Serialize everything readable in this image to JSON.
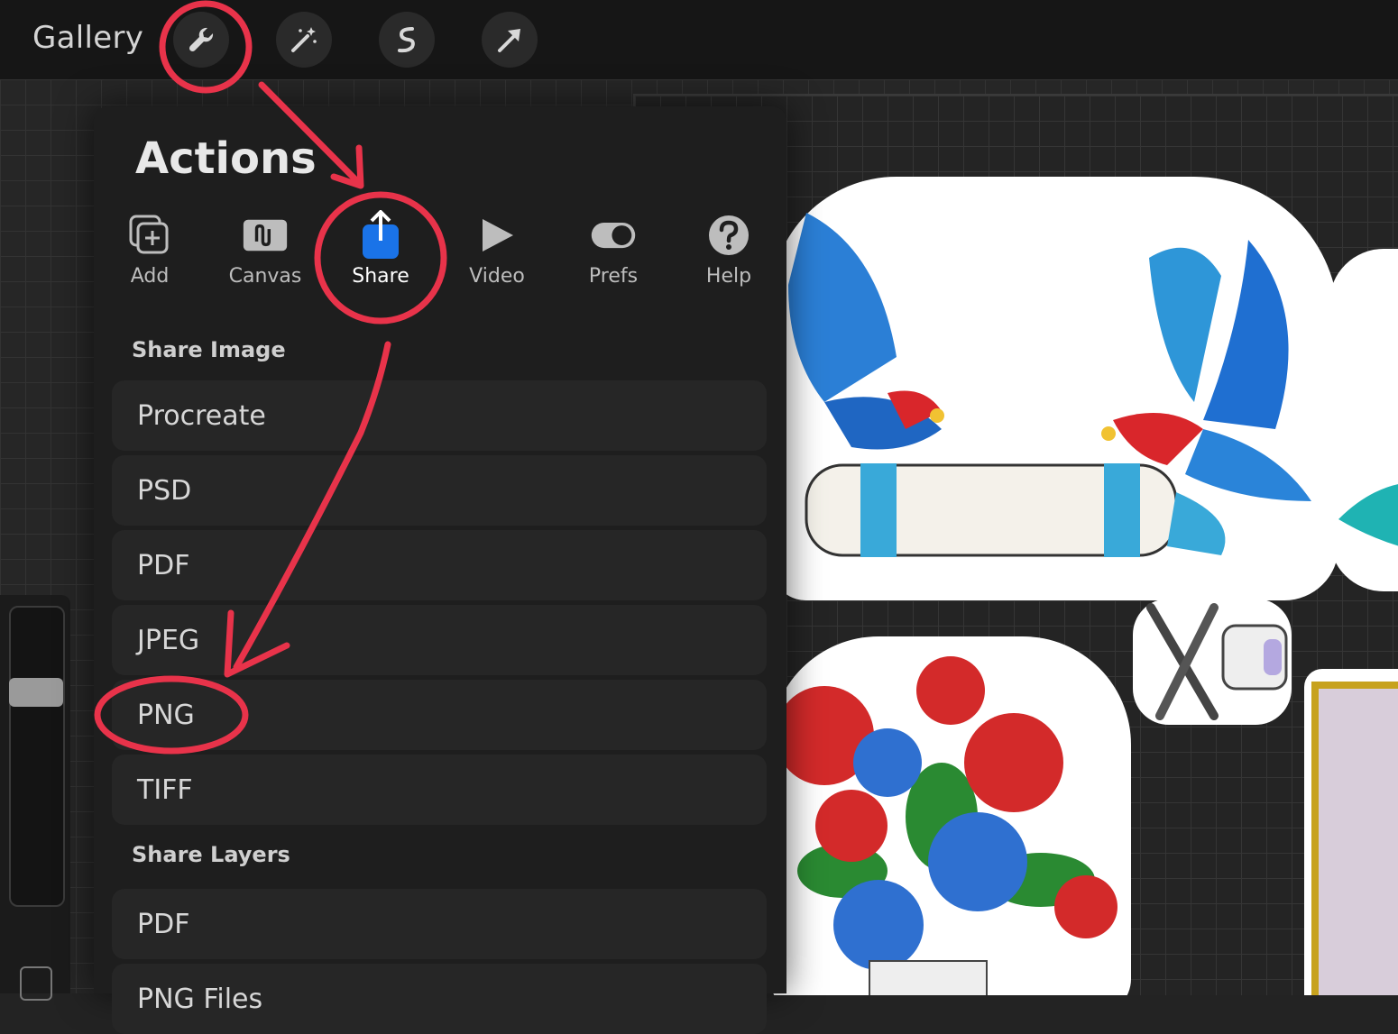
{
  "topbar": {
    "gallery_label": "Gallery",
    "tools": [
      {
        "icon": "wrench-icon"
      },
      {
        "icon": "magic-wand-icon"
      },
      {
        "icon": "selection-icon"
      },
      {
        "icon": "transform-arrow-icon"
      }
    ]
  },
  "panel": {
    "title": "Actions",
    "tabs": [
      {
        "label": "Add",
        "icon": "add-layer-icon"
      },
      {
        "label": "Canvas",
        "icon": "canvas-icon"
      },
      {
        "label": "Share",
        "icon": "share-icon",
        "active": true
      },
      {
        "label": "Video",
        "icon": "play-icon"
      },
      {
        "label": "Prefs",
        "icon": "toggle-icon"
      },
      {
        "label": "Help",
        "icon": "question-icon"
      }
    ],
    "share_image_header": "Share Image",
    "share_image_items": [
      "Procreate",
      "PSD",
      "PDF",
      "JPEG",
      "PNG",
      "TIFF"
    ],
    "share_layers_header": "Share Layers",
    "share_layers_items": [
      "PDF",
      "PNG Files"
    ]
  },
  "colors": {
    "accent_blue": "#1a73e8",
    "annotation_red": "#e8334a"
  }
}
